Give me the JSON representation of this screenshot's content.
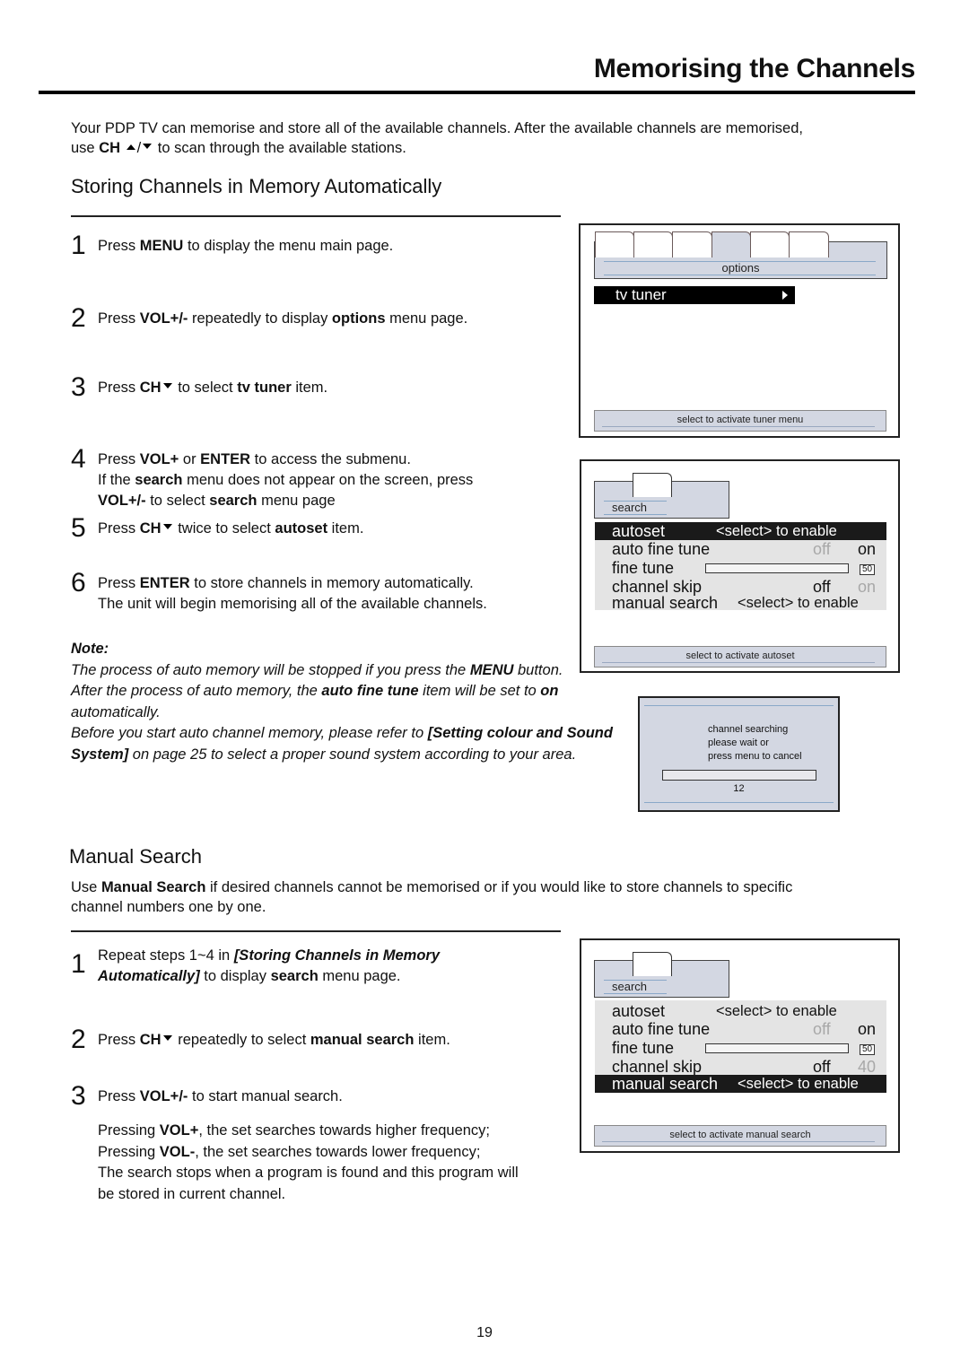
{
  "page": {
    "title": "Memorising the Channels",
    "page_number": "19"
  },
  "intro": {
    "line1": "Your PDP TV can memorise and store all of the available channels. After the available channels are memorised,",
    "line2_pre": "use ",
    "line2_bold": "CH",
    "line2_post": " to scan through the available stations.",
    "up_icon": "triangle-up",
    "down_icon": "triangle-down"
  },
  "auto_section": {
    "heading": "Storing Channels in Memory Automatically",
    "steps": [
      {
        "num": "1",
        "parts": [
          "Press ",
          "MENU",
          " to display the menu main page."
        ]
      },
      {
        "num": "2",
        "parts": [
          "Press ",
          "VOL+/-",
          " repeatedly to display ",
          "options",
          " menu page."
        ]
      },
      {
        "num": "3",
        "parts": [
          "Press ",
          "CH",
          " to select ",
          "tv tuner",
          " item."
        ]
      },
      {
        "num": "4",
        "lines": [
          [
            "Press ",
            "VOL+",
            " or ",
            "ENTER",
            " to access the submenu."
          ],
          [
            "If the ",
            "search",
            " menu does not appear on the screen, press"
          ],
          [
            "",
            "VOL+/-",
            " to select ",
            "search",
            " menu page"
          ]
        ]
      },
      {
        "num": "5",
        "parts": [
          "Press ",
          "CH",
          " twice to select ",
          "autoset",
          " item."
        ]
      },
      {
        "num": "6",
        "lines": [
          [
            "Press ",
            "ENTER",
            " to store channels in memory automatically."
          ],
          [
            "The unit will begin memorising all of the available channels."
          ]
        ]
      }
    ],
    "note": {
      "label": "Note:",
      "p1_a": "The process of auto memory will be stopped if you press the ",
      "p1_b": "MENU",
      "p1_c": " button. After the process of auto memory, the ",
      "p1_d": "auto fine tune",
      "p1_e": " item will be set to ",
      "p1_f": "on",
      "p1_g": " automatically.",
      "p2_a": "Before you start auto channel memory, please refer to ",
      "p2_b": "[Setting colour and Sound System]",
      "p2_c": " on page 25 to select a proper sound system according to your area."
    }
  },
  "screen_options": {
    "tab_label": "options",
    "tab_count": 6,
    "active_tab_index": 3,
    "item": "tv tuner",
    "item_arrow": "triangle-right",
    "status": "select to activate tuner menu"
  },
  "screen_search_auto": {
    "tab_label": "search",
    "rows": {
      "autoset": {
        "label": "autoset",
        "value": "<select> to enable"
      },
      "auto_fine_tune": {
        "label": "auto fine tune",
        "off": "off",
        "on": "on",
        "selected": "on"
      },
      "fine_tune": {
        "label": "fine tune",
        "value": "50"
      },
      "channel_skip": {
        "label": "channel skip",
        "off": "off",
        "on": "on",
        "selected": "off"
      },
      "manual_search": {
        "label": "manual search",
        "value": "<select> to enable"
      }
    },
    "highlighted": "autoset",
    "status": "select to activate autoset"
  },
  "screen_progress": {
    "line1": "channel searching",
    "line2": "please wait or",
    "line3": "press menu to cancel",
    "channel": "12"
  },
  "manual_section": {
    "heading": "Manual Search",
    "intro_a": "Use ",
    "intro_b": "Manual Search",
    "intro_c": " if desired channels cannot be memorised or if you would like to store channels to specific",
    "intro_d": "channel numbers one by one.",
    "steps": [
      {
        "num": "1",
        "l1_a": "Repeat steps 1~4 in ",
        "l1_b": "[Storing Channels in Memory",
        "l2_a": "Automatically]",
        "l2_b": " to display ",
        "l2_c": "search",
        "l2_d": " menu page."
      },
      {
        "num": "2",
        "a": "Press ",
        "b": "CH",
        "c": " repeatedly to select ",
        "d": "manual search",
        "e": " item."
      },
      {
        "num": "3",
        "a": "Press ",
        "b": "VOL+/-",
        "c": " to start manual search."
      }
    ],
    "details": {
      "l1_a": "Pressing ",
      "l1_b": "VOL+",
      "l1_c": ", the set searches towards higher frequency;",
      "l2_a": "Pressing ",
      "l2_b": "VOL-",
      "l2_c": ", the set searches towards lower frequency;",
      "l3": "The search stops when a program is found and this program will",
      "l4": "be stored in current channel."
    }
  },
  "screen_search_manual": {
    "tab_label": "search",
    "rows": {
      "autoset": {
        "label": "autoset",
        "value": "<select> to enable"
      },
      "auto_fine_tune": {
        "label": "auto fine tune",
        "off": "off",
        "on": "on",
        "selected": "on"
      },
      "fine_tune": {
        "label": "fine tune",
        "value": "50"
      },
      "channel_skip": {
        "label": "channel skip",
        "off": "off",
        "on": "40",
        "selected": "off"
      },
      "manual_search": {
        "label": "manual search",
        "value": "<select> to enable"
      }
    },
    "highlighted": "manual_search",
    "status": "select to activate manual search"
  }
}
